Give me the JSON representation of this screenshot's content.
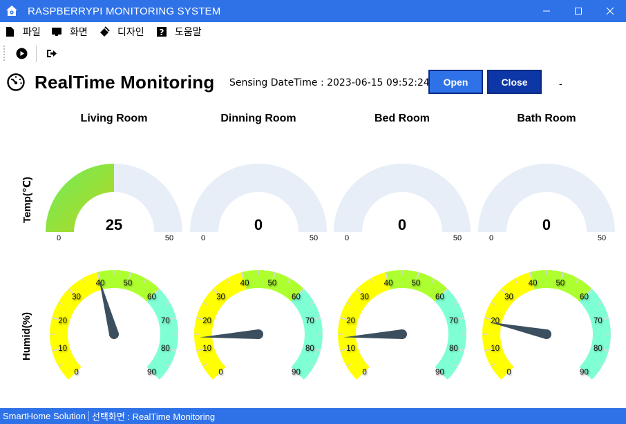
{
  "window": {
    "title": "RASPBERRYPI MONITORING SYSTEM"
  },
  "menu": [
    {
      "label": "파일",
      "icon": "file-icon"
    },
    {
      "label": "화면",
      "icon": "monitor-icon"
    },
    {
      "label": "디자인",
      "icon": "design-icon"
    },
    {
      "label": "도움말",
      "icon": "help-icon"
    }
  ],
  "toolbar": {
    "items": [
      "play-icon",
      "exit-icon"
    ]
  },
  "header": {
    "title": "RealTime Monitoring",
    "sensing_label": "Sensing DateTime : 2023-06-15 09:52:24",
    "open_label": "Open",
    "close_label": "Close",
    "dash": "-"
  },
  "rows": {
    "temp_label": "Temp(℃)",
    "humid_label": "Humid(%)"
  },
  "rooms": [
    "Living Room",
    "Dinning Room",
    "Bed Room",
    "Bath Room"
  ],
  "temperature": {
    "min": 0,
    "max": 50,
    "min_label": "0",
    "max_label": "50",
    "values": [
      25,
      0,
      0,
      0
    ],
    "value_labels": [
      "25",
      "0",
      "0",
      "0"
    ]
  },
  "humidity": {
    "min": 0,
    "max": 90,
    "ticks": [
      "0",
      "10",
      "20",
      "30",
      "40",
      "50",
      "60",
      "70",
      "80",
      "90"
    ],
    "bands": [
      {
        "from": 0,
        "to": 40,
        "color": "#ffff00"
      },
      {
        "from": 40,
        "to": 60,
        "color": "#adff2f"
      },
      {
        "from": 60,
        "to": 90,
        "color": "#7fffd4"
      }
    ],
    "values": [
      40,
      14,
      14,
      19
    ]
  },
  "colors": {
    "accent": "#2f72e8",
    "track": "#e7eef7",
    "needle": "#3c4f5f",
    "temp_fill_start": "#6dee5c",
    "temp_fill_end": "#b9d51f"
  },
  "status": {
    "left": "SmartHome Solution",
    "right": "선택화면 : RealTime Monitoring"
  }
}
